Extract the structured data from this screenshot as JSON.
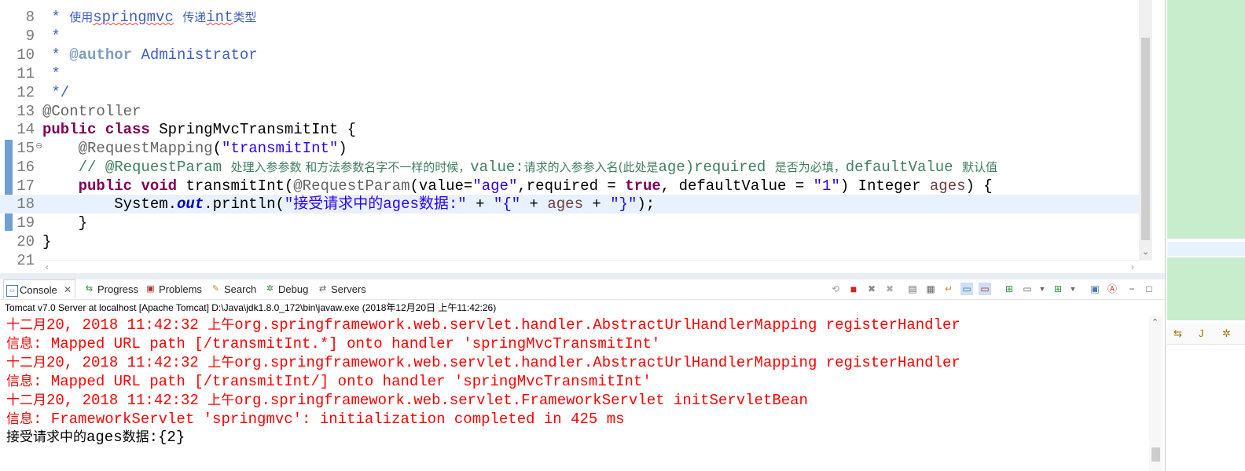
{
  "editor": {
    "lines": [
      {
        "num": "8",
        "segments": [
          {
            "t": " * ",
            "c": "cm"
          },
          {
            "t": "使用",
            "c": "cm cn"
          },
          {
            "t": "springmvc",
            "c": "cm squig"
          },
          {
            "t": " ",
            "c": "cm"
          },
          {
            "t": "传递",
            "c": "cm cn"
          },
          {
            "t": "int",
            "c": "cm squig"
          },
          {
            "t": "类型",
            "c": "cm cn"
          }
        ]
      },
      {
        "num": "9",
        "segments": [
          {
            "t": " *",
            "c": "cm"
          }
        ]
      },
      {
        "num": "10",
        "segments": [
          {
            "t": " * ",
            "c": "cm"
          },
          {
            "t": "@author",
            "c": "tag"
          },
          {
            "t": " Administrator",
            "c": "cm"
          }
        ]
      },
      {
        "num": "11",
        "segments": [
          {
            "t": " *",
            "c": "cm"
          }
        ]
      },
      {
        "num": "12",
        "segments": [
          {
            "t": " */",
            "c": "cm"
          }
        ]
      },
      {
        "num": "13",
        "segments": [
          {
            "t": "@Controller",
            "c": "ann"
          }
        ]
      },
      {
        "num": "14",
        "segments": [
          {
            "t": "public",
            "c": "kw"
          },
          {
            "t": " ",
            "c": ""
          },
          {
            "t": "class",
            "c": "kw"
          },
          {
            "t": " SpringMvcTransmitInt {",
            "c": ""
          }
        ]
      },
      {
        "num": "15",
        "fold": "⊖",
        "segments": [
          {
            "t": "    @RequestMapping",
            "c": "ann"
          },
          {
            "t": "(",
            "c": ""
          },
          {
            "t": "\"transmitInt\"",
            "c": "str"
          },
          {
            "t": ")",
            "c": ""
          }
        ]
      },
      {
        "num": "16",
        "segments": [
          {
            "t": "    // @RequestParam ",
            "c": "lc"
          },
          {
            "t": "处理入参参数 和方法参数名字不一样的时候，",
            "c": "lc cn"
          },
          {
            "t": "value:",
            "c": "lc"
          },
          {
            "t": "请求的入参参入名(此处是",
            "c": "lc cn"
          },
          {
            "t": "age)required ",
            "c": "lc"
          },
          {
            "t": "是否为必填，",
            "c": "lc cn"
          },
          {
            "t": "defaultValue ",
            "c": "lc"
          },
          {
            "t": "默认值",
            "c": "lc cn"
          }
        ]
      },
      {
        "num": "17",
        "segments": [
          {
            "t": "    ",
            "c": ""
          },
          {
            "t": "public",
            "c": "kw"
          },
          {
            "t": " ",
            "c": ""
          },
          {
            "t": "void",
            "c": "kw"
          },
          {
            "t": " transmitInt(",
            "c": ""
          },
          {
            "t": "@RequestParam",
            "c": "ann"
          },
          {
            "t": "(value=",
            "c": ""
          },
          {
            "t": "\"age\"",
            "c": "str"
          },
          {
            "t": ",required = ",
            "c": ""
          },
          {
            "t": "true",
            "c": "kw"
          },
          {
            "t": ", defaultValue = ",
            "c": ""
          },
          {
            "t": "\"1\"",
            "c": "str"
          },
          {
            "t": ") Integer ",
            "c": ""
          },
          {
            "t": "ages",
            "c": "var"
          },
          {
            "t": ") {",
            "c": ""
          }
        ]
      },
      {
        "num": "18",
        "current": true,
        "segments": [
          {
            "t": "        System.",
            "c": ""
          },
          {
            "t": "out",
            "c": "fld"
          },
          {
            "t": ".println(",
            "c": ""
          },
          {
            "t": "\"接受请求中的ages数据:\"",
            "c": "str"
          },
          {
            "t": " + ",
            "c": ""
          },
          {
            "t": "\"{\"",
            "c": "str"
          },
          {
            "t": " + ",
            "c": ""
          },
          {
            "t": "ages",
            "c": "var"
          },
          {
            "t": " + ",
            "c": ""
          },
          {
            "t": "\"}\"",
            "c": "str"
          },
          {
            "t": ");",
            "c": ""
          }
        ]
      },
      {
        "num": "19",
        "segments": [
          {
            "t": "    }",
            "c": ""
          }
        ]
      },
      {
        "num": "20",
        "segments": [
          {
            "t": "}",
            "c": ""
          }
        ]
      },
      {
        "num": "21",
        "segments": []
      }
    ]
  },
  "tabs": [
    {
      "label": "Console",
      "icon": "console-icon",
      "active": true
    },
    {
      "label": "Progress",
      "icon": "progress-icon"
    },
    {
      "label": "Problems",
      "icon": "problems-icon"
    },
    {
      "label": "Search",
      "icon": "search-icon"
    },
    {
      "label": "Debug",
      "icon": "debug-icon"
    },
    {
      "label": "Servers",
      "icon": "servers-icon"
    }
  ],
  "console": {
    "description": "Tomcat v7.0 Server at localhost [Apache Tomcat] D:\\Java\\jdk1.8.0_172\\bin\\javaw.exe (2018年12月20日 上午11:42:26)",
    "lines": [
      {
        "color": "red",
        "segments": [
          {
            "t": "十二月",
            "cn": true
          },
          {
            "t": "20, 2018 11:42:32 "
          },
          {
            "t": "上午",
            "cn": true
          },
          {
            "t": "org.springframework.web.servlet.handler.AbstractUrlHandlerMapping registerHandler"
          }
        ]
      },
      {
        "color": "red",
        "segments": [
          {
            "t": "信息",
            "cn": true
          },
          {
            "t": ": Mapped URL path [/transmitInt.*] onto handler 'springMvcTransmitInt'"
          }
        ]
      },
      {
        "color": "red",
        "segments": [
          {
            "t": "十二月",
            "cn": true
          },
          {
            "t": "20, 2018 11:42:32 "
          },
          {
            "t": "上午",
            "cn": true
          },
          {
            "t": "org.springframework.web.servlet.handler.AbstractUrlHandlerMapping registerHandler"
          }
        ]
      },
      {
        "color": "red",
        "segments": [
          {
            "t": "信息",
            "cn": true
          },
          {
            "t": ": Mapped URL path [/transmitInt/] onto handler 'springMvcTransmitInt'"
          }
        ]
      },
      {
        "color": "red",
        "segments": [
          {
            "t": "十二月",
            "cn": true
          },
          {
            "t": "20, 2018 11:42:32 "
          },
          {
            "t": "上午",
            "cn": true
          },
          {
            "t": "org.springframework.web.servlet.FrameworkServlet initServletBean"
          }
        ]
      },
      {
        "color": "red",
        "segments": [
          {
            "t": "信息",
            "cn": true
          },
          {
            "t": ": FrameworkServlet 'springmvc': initialization completed in 425 ms"
          }
        ]
      },
      {
        "color": "black",
        "segments": [
          {
            "t": "接受请求中的",
            "cn": true
          },
          {
            "t": "ages"
          },
          {
            "t": "数据",
            "cn": true
          },
          {
            "t": ":{2}"
          }
        ]
      }
    ]
  },
  "toolbar_icons": [
    "remove-launch-icon",
    "terminate-icon",
    "remove-icon",
    "remove-all-icon",
    "clear-console-icon",
    "scroll-lock-icon",
    "word-wrap-icon",
    "show-stdout-icon",
    "show-stderr-icon",
    "pin-console-icon",
    "display-console-icon",
    "dropdown-icon",
    "open-console-icon",
    "dropdown-icon",
    "outline-icon",
    "jrebel-icon",
    "minimize-icon",
    "maximize-icon"
  ],
  "colors": {
    "red": "#ff0000",
    "black": "#000000",
    "accent": "#3f7fc4"
  }
}
